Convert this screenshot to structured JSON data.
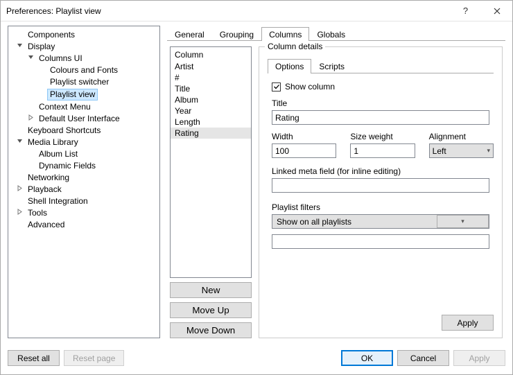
{
  "window": {
    "title": "Preferences: Playlist view"
  },
  "tree": [
    {
      "label": "Components"
    },
    {
      "label": "Display",
      "expanded": true,
      "children": [
        {
          "label": "Columns UI",
          "expanded": true,
          "children": [
            {
              "label": "Colours and Fonts"
            },
            {
              "label": "Playlist switcher"
            },
            {
              "label": "Playlist view",
              "selected": true
            }
          ]
        },
        {
          "label": "Context Menu"
        },
        {
          "label": "Default User Interface",
          "expandable": true
        }
      ]
    },
    {
      "label": "Keyboard Shortcuts"
    },
    {
      "label": "Media Library",
      "expanded": true,
      "children": [
        {
          "label": "Album List"
        },
        {
          "label": "Dynamic Fields"
        }
      ]
    },
    {
      "label": "Networking"
    },
    {
      "label": "Playback",
      "expandable": true
    },
    {
      "label": "Shell Integration"
    },
    {
      "label": "Tools",
      "expandable": true
    },
    {
      "label": "Advanced"
    }
  ],
  "main_tabs": [
    {
      "label": "General",
      "active": false
    },
    {
      "label": "Grouping",
      "active": false
    },
    {
      "label": "Columns",
      "active": true
    },
    {
      "label": "Globals",
      "active": false
    }
  ],
  "columns": {
    "header": "Column",
    "items": [
      {
        "label": "Artist",
        "selected": false
      },
      {
        "label": "#",
        "selected": false
      },
      {
        "label": "Title",
        "selected": false
      },
      {
        "label": "Album",
        "selected": false
      },
      {
        "label": "Year",
        "selected": false
      },
      {
        "label": "Length",
        "selected": false
      },
      {
        "label": "Rating",
        "selected": true
      }
    ],
    "buttons": {
      "new": "New",
      "move_up": "Move Up",
      "move_down": "Move Down"
    }
  },
  "details": {
    "legend": "Column details",
    "subtabs": [
      {
        "label": "Options",
        "active": true
      },
      {
        "label": "Scripts",
        "active": false
      }
    ],
    "show_column_checked": true,
    "show_column_label": "Show column",
    "title": {
      "label": "Title",
      "value": "Rating"
    },
    "width": {
      "label": "Width",
      "value": "100"
    },
    "size_weight": {
      "label": "Size weight",
      "value": "1"
    },
    "alignment": {
      "label": "Alignment",
      "value": "Left"
    },
    "linked_meta": {
      "label": "Linked meta field (for inline editing)",
      "value": ""
    },
    "playlist_filters": {
      "label": "Playlist filters",
      "value": "Show on all playlists",
      "extra": ""
    },
    "apply_label": "Apply"
  },
  "footer": {
    "reset_all": "Reset all",
    "reset_page": "Reset page",
    "ok": "OK",
    "cancel": "Cancel",
    "apply": "Apply"
  }
}
